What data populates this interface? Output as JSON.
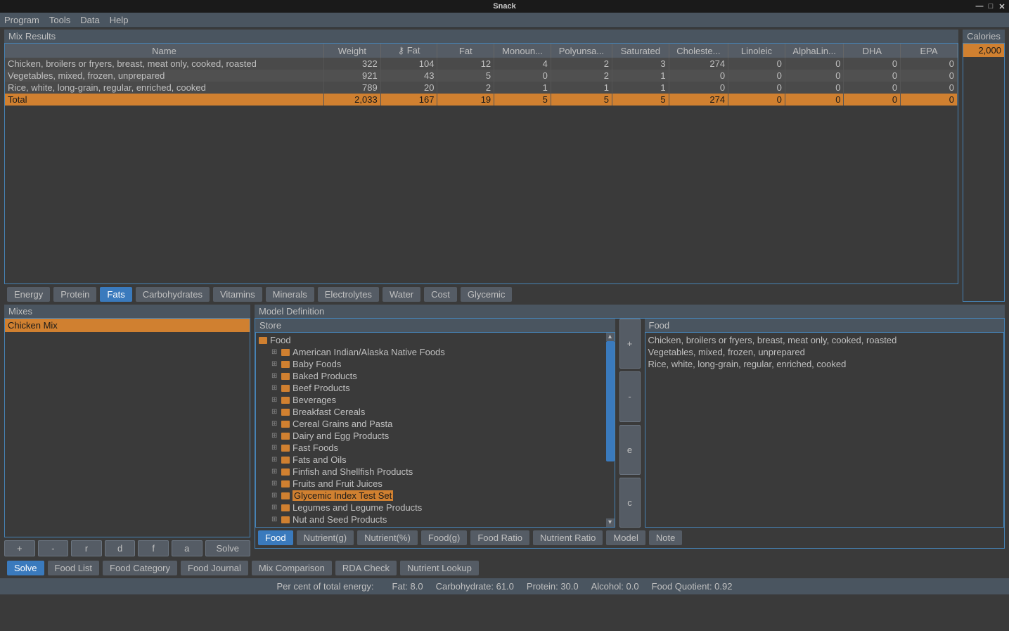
{
  "window": {
    "title": "Snack"
  },
  "menu": [
    "Program",
    "Tools",
    "Data",
    "Help"
  ],
  "mix_results": {
    "title": "Mix Results",
    "columns": [
      "Name",
      "Weight",
      "⚷ Fat",
      "Fat",
      "Monoun...",
      "Polyunsa...",
      "Saturated",
      "Choleste...",
      "Linoleic",
      "AlphaLin...",
      "DHA",
      "EPA"
    ],
    "rows": [
      {
        "cells": [
          "Chicken, broilers or fryers, breast, meat only, cooked, roasted",
          "322",
          "104",
          "12",
          "4",
          "2",
          "3",
          "274",
          "0",
          "0",
          "0",
          "0"
        ]
      },
      {
        "cells": [
          "Vegetables, mixed, frozen, unprepared",
          "921",
          "43",
          "5",
          "0",
          "2",
          "1",
          "0",
          "0",
          "0",
          "0",
          "0"
        ]
      },
      {
        "cells": [
          "Rice, white, long-grain, regular, enriched, cooked",
          "789",
          "20",
          "2",
          "1",
          "1",
          "1",
          "0",
          "0",
          "0",
          "0",
          "0"
        ]
      }
    ],
    "total": {
      "cells": [
        "Total",
        "2,033",
        "167",
        "19",
        "5",
        "5",
        "5",
        "274",
        "0",
        "0",
        "0",
        "0"
      ]
    }
  },
  "calories": {
    "label": "Calories",
    "value": "2,000"
  },
  "nutrient_tabs": [
    "Energy",
    "Protein",
    "Fats",
    "Carbohydrates",
    "Vitamins",
    "Minerals",
    "Electrolytes",
    "Water",
    "Cost",
    "Glycemic"
  ],
  "nutrient_tabs_active": 2,
  "mixes": {
    "title": "Mixes",
    "items": [
      "Chicken Mix"
    ],
    "buttons": [
      "+",
      "-",
      "r",
      "d",
      "f",
      "a",
      "Solve"
    ]
  },
  "model_def": {
    "title": "Model Definition",
    "store_label": "Store",
    "tree_root": "Food",
    "tree_children": [
      "American Indian/Alaska Native Foods",
      "Baby Foods",
      "Baked Products",
      "Beef Products",
      "Beverages",
      "Breakfast Cereals",
      "Cereal Grains and Pasta",
      "Dairy and Egg Products",
      "Fast Foods",
      "Fats and Oils",
      "Finfish and Shellfish Products",
      "Fruits and Fruit Juices",
      "Glycemic Index Test Set",
      "Legumes and Legume Products",
      "Nut and Seed Products"
    ],
    "tree_selected": 12,
    "store_buttons": [
      "+",
      "-",
      "e",
      "c"
    ],
    "food_label": "Food",
    "food_items": [
      "Chicken, broilers or fryers, breast, meat only, cooked, roasted",
      "Vegetables, mixed, frozen, unprepared",
      "Rice, white, long-grain, regular, enriched, cooked"
    ],
    "tabs": [
      "Food",
      "Nutrient(g)",
      "Nutrient(%)",
      "Food(g)",
      "Food Ratio",
      "Nutrient Ratio",
      "Model",
      "Note"
    ],
    "tabs_active": 0
  },
  "bottom_tabs": [
    "Solve",
    "Food List",
    "Food Category",
    "Food Journal",
    "Mix Comparison",
    "RDA Check",
    "Nutrient Lookup"
  ],
  "bottom_tabs_active": 0,
  "status": {
    "label": "Per cent of total energy:",
    "items": [
      "Fat: 8.0",
      "Carbohydrate: 61.0",
      "Protein: 30.0",
      "Alcohol: 0.0",
      "Food Quotient: 0.92"
    ]
  }
}
